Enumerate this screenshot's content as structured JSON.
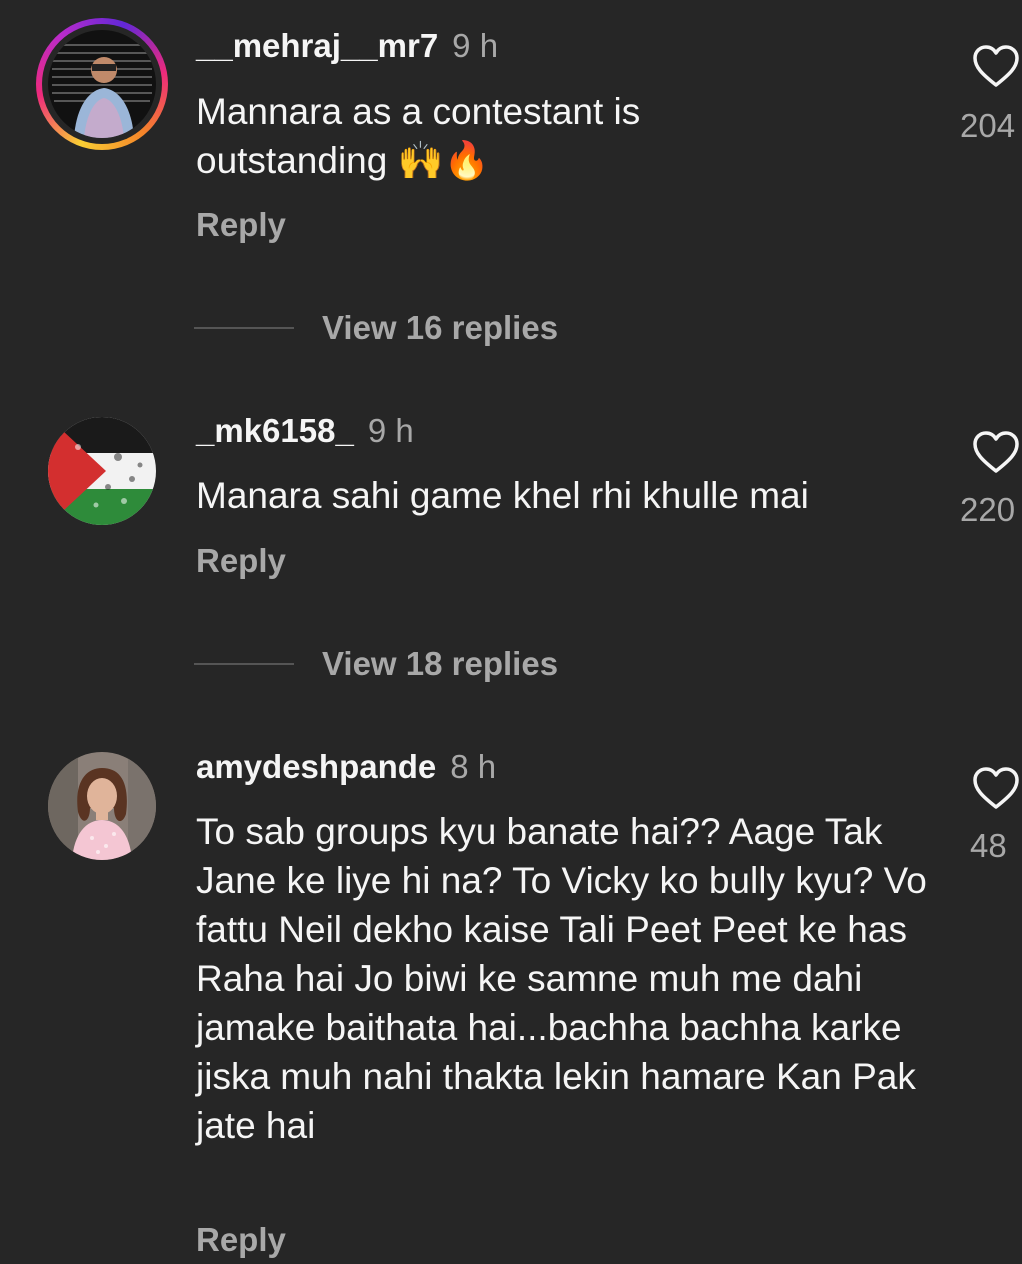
{
  "comments": [
    {
      "username": "__mehraj__mr7",
      "time": "9 h",
      "text": "Mannara as a contestant is outstanding 🙌🔥",
      "reply_label": "Reply",
      "likes": "204",
      "view_replies": "View 16 replies",
      "has_story": true
    },
    {
      "username": "_mk6158_",
      "time": "9 h",
      "text": "Manara sahi game khel rhi khulle mai",
      "reply_label": "Reply",
      "likes": "220",
      "view_replies": "View 18 replies",
      "has_story": false
    },
    {
      "username": "amydeshpande",
      "time": "8 h",
      "text": "To sab groups kyu banate hai?? Aage Tak Jane ke liye hi na? To Vicky ko bully kyu? Vo fattu Neil dekho kaise Tali Peet Peet ke has Raha hai Jo biwi ke samne muh me dahi jamake baithata hai...bachha bachha karke jiska muh nahi thakta lekin hamare Kan Pak jate hai",
      "reply_label": "Reply",
      "likes": "48",
      "has_story": false
    }
  ],
  "colors": {
    "background": "#262626",
    "primary_text": "#f5f5f5",
    "secondary_text": "#a8a8a8"
  },
  "icons": {
    "like": "heart-outline-icon"
  }
}
